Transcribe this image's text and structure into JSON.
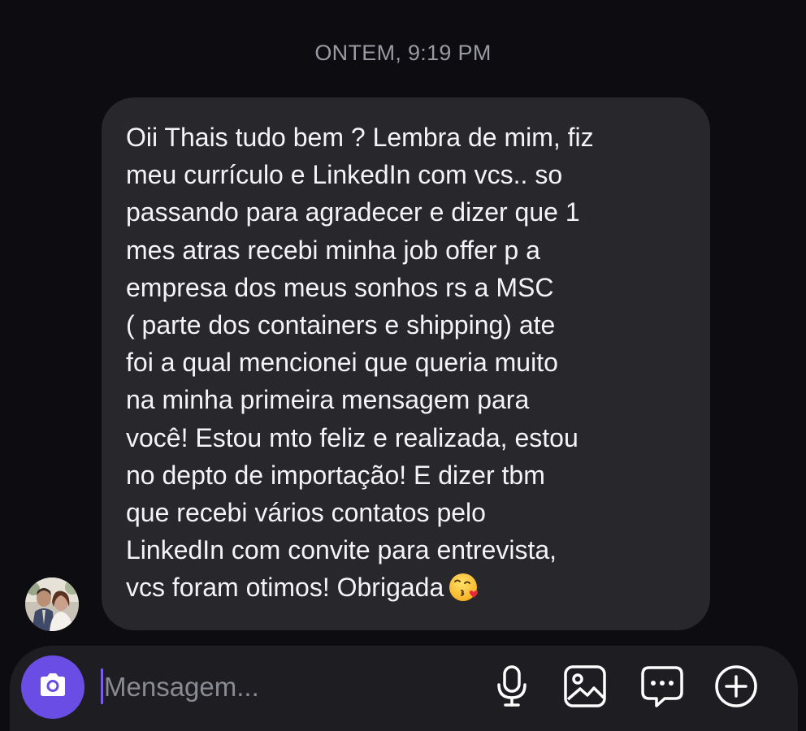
{
  "header": {
    "timestamp": "ONTEM, 9:19 PM"
  },
  "message": {
    "text": "Oii Thais tudo bem ? Lembra de mim, fiz\nmeu currículo e LinkedIn com vcs.. so\npassando para agradecer e dizer que 1\nmes atras recebi minha job offer p a\nempresa dos meus sonhos rs a MSC\n( parte dos containers e shipping) ate\nfoi a qual mencionei que queria muito\nna minha primeira mensagem para\nvocê! Estou mto feliz e realizada, estou\nno depto de importação! E dizer tbm\nque recebi vários contatos pelo\nLinkedIn com convite para entrevista,\nvcs foram otimos! Obrigada",
    "emoji": "face-blowing-a-kiss"
  },
  "composer": {
    "placeholder": "Mensagem...",
    "value": "",
    "icons": [
      "camera-icon",
      "microphone-icon",
      "gallery-icon",
      "sticker-icon",
      "plus-icon"
    ]
  },
  "colors": {
    "background": "#0c0c11",
    "bubble": "#27272c",
    "accent": "#6a4de4",
    "timestamp": "#9a9aa3"
  }
}
